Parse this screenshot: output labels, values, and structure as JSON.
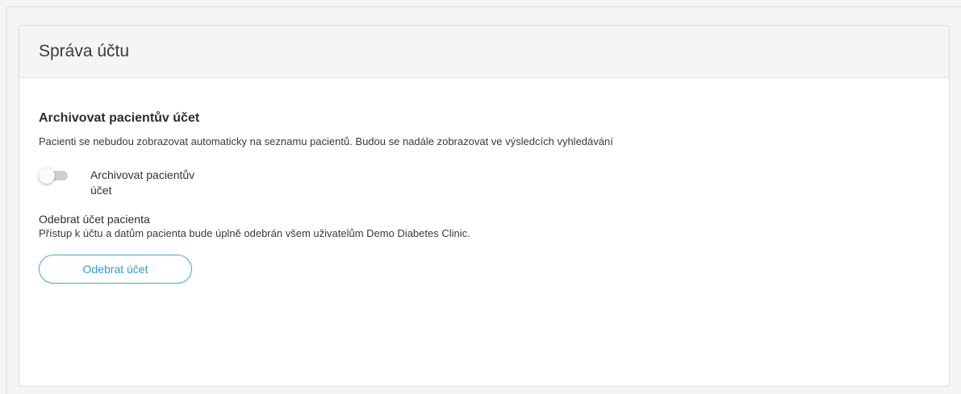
{
  "card": {
    "title": "Správa účtu"
  },
  "archive": {
    "title": "Archivovat pacientův účet",
    "description": "Pacienti se nebudou zobrazovat automaticky na seznamu pacientů. Budou se nadále zobrazovat ve výsledcích vyhledávání",
    "toggle_label_line1": "Archivovat pacientův",
    "toggle_label_line2": "účet",
    "toggle_state": "off"
  },
  "remove": {
    "title": "Odebrat účet pacienta",
    "description": "Přístup k účtu a datům pacienta bude úplně odebrán všem uživatelům Demo Diabetes Clinic.",
    "button_label": "Odebrat účet"
  },
  "colors": {
    "accent": "#2a9fd6",
    "header_bg": "#f5f5f5",
    "toggle_track": "#cfcfcf"
  }
}
